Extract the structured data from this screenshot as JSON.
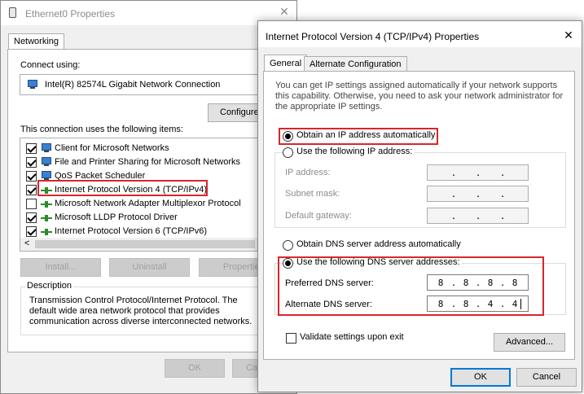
{
  "eth": {
    "title": "Ethernet0 Properties",
    "close": "✕",
    "tab": "Networking",
    "connect_using_label": "Connect using:",
    "adapter": "Intel(R) 82574L Gigabit Network Connection",
    "configure": "Configure",
    "items_label": "This connection uses the following items:",
    "items": [
      {
        "label": "Client for Microsoft Networks",
        "checked": true
      },
      {
        "label": "File and Printer Sharing for Microsoft Networks",
        "checked": true
      },
      {
        "label": "QoS Packet Scheduler",
        "checked": true
      },
      {
        "label": "Internet Protocol Version 4 (TCP/IPv4)",
        "checked": true
      },
      {
        "label": "Microsoft Network Adapter Multiplexor Protocol",
        "checked": false
      },
      {
        "label": "Microsoft LLDP Protocol Driver",
        "checked": true
      },
      {
        "label": "Internet Protocol Version 6 (TCP/IPv6)",
        "checked": true
      }
    ],
    "scroll_left": "<",
    "install": "Install...",
    "uninstall": "Uninstall",
    "properties": "Properties",
    "description_label": "Description",
    "description": "Transmission Control Protocol/Internet Protocol. The default wide area network protocol that provides communication across diverse interconnected networks.",
    "ok": "OK",
    "cancel": "Ca"
  },
  "ipv4": {
    "title": "Internet Protocol Version 4 (TCP/IPv4) Properties",
    "close": "✕",
    "tabs": [
      "General",
      "Alternate Configuration"
    ],
    "intro": "You can get IP settings assigned automatically if your network supports this capability. Otherwise, you need to ask your network administrator for the appropriate IP settings.",
    "obtain_ip_auto": "Obtain an IP address automatically",
    "use_ip": "Use the following IP address:",
    "ip_address_label": "IP address:",
    "subnet_label": "Subnet mask:",
    "gateway_label": "Default gateway:",
    "dot": ".",
    "obtain_dns_auto": "Obtain DNS server address automatically",
    "use_dns": "Use the following DNS server addresses:",
    "preferred_dns_label": "Preferred DNS server:",
    "preferred_dns": [
      "8",
      "8",
      "8",
      "8"
    ],
    "alternate_dns_label": "Alternate DNS server:",
    "alternate_dns": [
      "8",
      "8",
      "4",
      "4"
    ],
    "validate_label": "Validate settings upon exit",
    "advanced": "Advanced...",
    "ok": "OK",
    "cancel": "Cancel"
  },
  "colors": {
    "highlight": "#d9262c",
    "accent": "#0078d7"
  }
}
